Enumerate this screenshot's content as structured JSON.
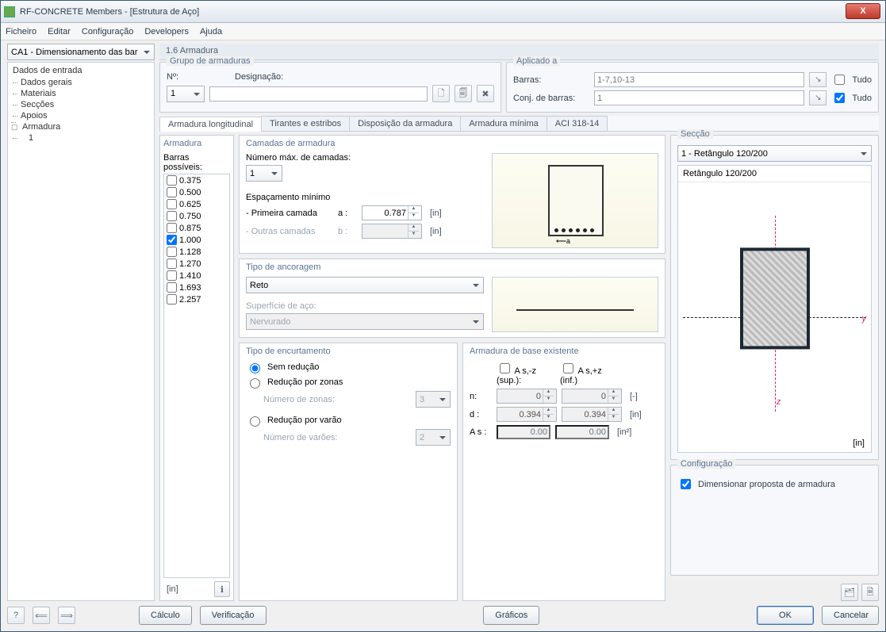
{
  "window": {
    "title": "RF-CONCRETE Members - [Estrutura de Aço]",
    "close": "X"
  },
  "menu": {
    "file": "Ficheiro",
    "edit": "Editar",
    "config": "Configuração",
    "dev": "Developers",
    "help": "Ajuda"
  },
  "case_combo": "CA1 - Dimensionamento das bar",
  "page_title": "1.6 Armadura",
  "nav": {
    "root": "Dados de entrada",
    "items": [
      "Dados gerais",
      "Materiais",
      "Secções",
      "Apoios"
    ],
    "armadura": "Armadura",
    "armadura_sub": "1"
  },
  "group_reb": {
    "legend": "Grupo de armaduras",
    "no_label": "Nº:",
    "no_value": "1",
    "desig_label": "Designação:",
    "desig_value": ""
  },
  "applied": {
    "legend": "Aplicado a",
    "barras_label": "Barras:",
    "barras_value": "1-7,10-13",
    "conj_label": "Conj. de barras:",
    "conj_value": "1",
    "tudo": "Tudo"
  },
  "tabs": {
    "t1": "Armadura longitudinal",
    "t2": "Tirantes e estribos",
    "t3": "Disposição da armadura",
    "t4": "Armadura mínima",
    "t5": "ACI 318-14"
  },
  "armadura": {
    "legend": "Armadura",
    "possible": "Barras possíveis:",
    "bars": [
      "0.375",
      "0.500",
      "0.625",
      "0.750",
      "0.875",
      "1.000",
      "1.128",
      "1.270",
      "1.410",
      "1.693",
      "2.257"
    ],
    "checked": "1.000",
    "unit": "[in]"
  },
  "camadas": {
    "legend": "Camadas de armadura",
    "max_label": "Número máx. de camadas:",
    "max_value": "1",
    "esp_title": "Espaçamento mínimo",
    "row1_label": "- Primeira camada",
    "row1_sym": "a :",
    "row1_val": "0.787",
    "unit": "[in]",
    "row2_label": "- Outras camadas",
    "row2_sym": "b :"
  },
  "ancoragem": {
    "legend": "Tipo de ancoragem",
    "tipo": "Reto",
    "surf_label": "Superfície de aço:",
    "surf_value": "Nervurado"
  },
  "encurt": {
    "legend": "Tipo de encurtamento",
    "r1": "Sem redução",
    "r2": "Redução por zonas",
    "r3": "Redução por varão",
    "zones_label": "Número de zonas:",
    "zones_val": "3",
    "bars_label": "Número de varões:",
    "bars_val": "2"
  },
  "base": {
    "legend": "Armadura de base existente",
    "as_sup": "A s,-z (sup.):",
    "as_inf": "A s,+z (inf.)",
    "n_label": "n:",
    "n1": "0",
    "n2": "0",
    "n_unit": "[-]",
    "d_label": "d :",
    "d1": "0.394",
    "d2": "0.394",
    "d_unit": "[in]",
    "as_label": "A s :",
    "as1": "0.00",
    "as2": "0.00",
    "as_unit": "[in²]"
  },
  "section": {
    "legend": "Secção",
    "combo": "1 - Retângulo 120/200",
    "name": "Retângulo 120/200",
    "unit": "[in]"
  },
  "config": {
    "legend": "Configuração",
    "chk": "Dimensionar proposta de armadura"
  },
  "footer": {
    "calc": "Cálculo",
    "verify": "Verificação",
    "graph": "Gráficos",
    "ok": "OK",
    "cancel": "Cancelar"
  }
}
